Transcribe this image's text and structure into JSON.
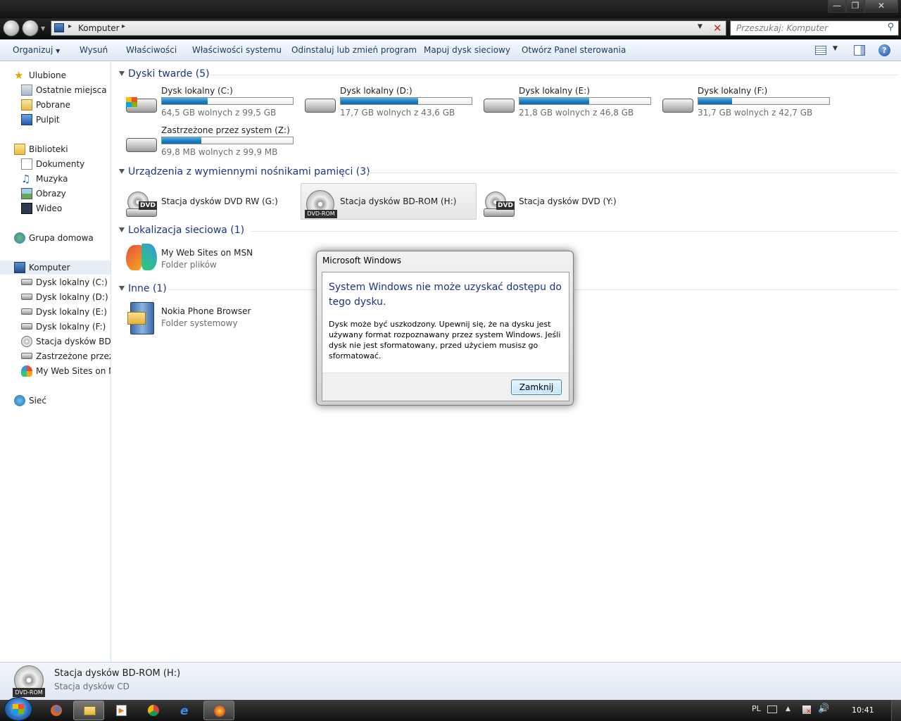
{
  "address": {
    "crumb": "Komputer",
    "search_placeholder": "Przeszukaj: Komputer"
  },
  "toolbar": {
    "organize": "Organizuj",
    "eject": "Wysuń",
    "properties": "Właściwości",
    "system_properties": "Właściwości systemu",
    "uninstall": "Odinstaluj lub zmień program",
    "map_drive": "Mapuj dysk sieciowy",
    "control_panel": "Otwórz Panel sterowania"
  },
  "sidebar": {
    "favorites": "Ulubione",
    "recent": "Ostatnie miejsca",
    "downloads": "Pobrane",
    "desktop": "Pulpit",
    "libraries": "Biblioteki",
    "documents": "Dokumenty",
    "music": "Muzyka",
    "pictures": "Obrazy",
    "videos": "Wideo",
    "homegroup": "Grupa domowa",
    "computer": "Komputer",
    "computer_items": [
      "Dysk lokalny (C:)",
      "Dysk lokalny (D:)",
      "Dysk lokalny (E:)",
      "Dysk lokalny (F:)",
      "Stacja dysków BD-ROM (H:)",
      "Zastrzeżone przez system (Z:)",
      "My Web Sites on MSN"
    ],
    "network": "Sieć"
  },
  "groups": {
    "hard_drives": "Dyski twarde (5)",
    "removable": "Urządzenia z wymiennymi nośnikami pamięci (3)",
    "network": "Lokalizacja sieciowa (1)",
    "other": "Inne (1)"
  },
  "drives": [
    {
      "name": "Dysk lokalny (C:)",
      "free": "64,5 GB wolnych z 99,5 GB",
      "used_fraction": 0.35
    },
    {
      "name": "Dysk lokalny (D:)",
      "free": "17,7 GB wolnych z 43,6 GB",
      "used_fraction": 0.59
    },
    {
      "name": "Dysk lokalny (E:)",
      "free": "21,8 GB wolnych z 46,8 GB",
      "used_fraction": 0.53
    },
    {
      "name": "Dysk lokalny (F:)",
      "free": "31,7 GB wolnych z 42,7 GB",
      "used_fraction": 0.26
    },
    {
      "name": "Zastrzeżone przez system (Z:)",
      "free": "69,8 MB wolnych z 99,9 MB",
      "used_fraction": 0.3
    }
  ],
  "removable": [
    {
      "name": "Stacja dysków DVD RW (G:)",
      "badge": "DVD"
    },
    {
      "name": "Stacja dysków BD-ROM (H:)",
      "badge": "DVD-ROM"
    },
    {
      "name": "Stacja dysków DVD (Y:)",
      "badge": "DVD"
    }
  ],
  "network_items": [
    {
      "name": "My Web Sites on MSN",
      "type": "Folder plików"
    }
  ],
  "other_items": [
    {
      "name": "Nokia Phone Browser",
      "type": "Folder systemowy"
    }
  ],
  "dialog": {
    "title": "Microsoft Windows",
    "heading": "System Windows nie może uzyskać dostępu do tego dysku.",
    "message": "Dysk może być uszkodzony. Upewnij się, że na dysku jest używany format rozpoznawany przez system Windows. Jeśli dysk nie jest sformatowany, przed użyciem musisz go sformatować.",
    "close_label": "Zamknij"
  },
  "statusbar": {
    "name": "Stacja dysków BD-ROM (H:)",
    "type": "Stacja dysków CD",
    "badge": "DVD-ROM"
  },
  "taskbar": {
    "language": "PL",
    "time": "10:41"
  },
  "colors": {
    "accent": "#1e3287",
    "bar_fill": "#1b7fc2",
    "selection": "#e8eef6"
  }
}
